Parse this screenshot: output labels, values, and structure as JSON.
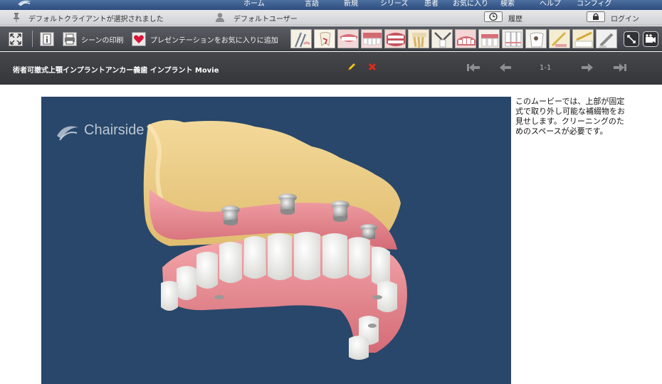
{
  "menubar": {
    "items": [
      "ホーム",
      "言語",
      "新規",
      "シリーズ",
      "患者",
      "お気に入り",
      "検索",
      "ヘルプ",
      "コンフィグ"
    ]
  },
  "statusbar": {
    "client": "デフォルトクライアントが選択されました",
    "user": "デフォルトユーザー",
    "history": "履歴",
    "login": "ログイン"
  },
  "toolbar": {
    "print_label": "シーンの印刷",
    "favorite_label": "プレゼンテーションをお気に入りに追加",
    "thumbnail_count": 14
  },
  "titlebar": {
    "title": "術者可撤式上顎インプラントアンカー義歯  インプラント  Movie",
    "page": "1-1"
  },
  "video": {
    "brand": "Chairside"
  },
  "description": "このムービーでは、上部が固定式で取り外し可能な補綴物をお見せします。クリーニングのためのスペースが必要です。",
  "colors": {
    "menubar": "#3b5d8f",
    "toolbar": "#4d5055",
    "titlebar": "#3c3e42",
    "video_bg": "#28476a",
    "edit_pencil": "#f5c518",
    "delete_x": "#e02a1a"
  }
}
